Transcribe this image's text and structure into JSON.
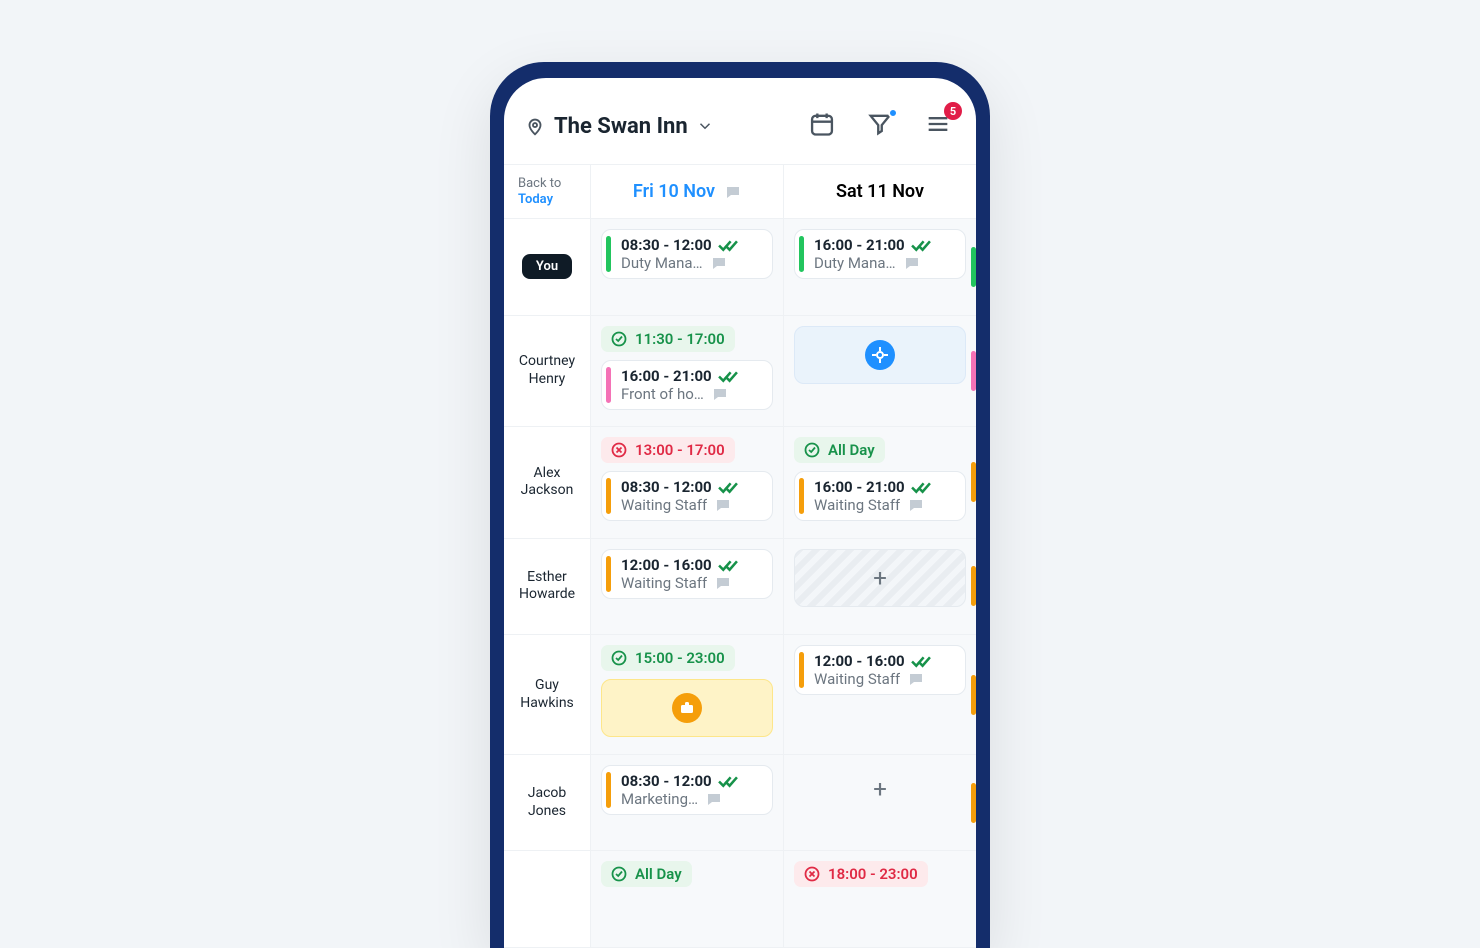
{
  "header": {
    "location": "The Swan Inn",
    "notifications": "5"
  },
  "dates": {
    "back": {
      "line1": "Back to",
      "line2": "Today"
    },
    "day1": "Fri 10 Nov",
    "day2": "Sat 11 Nov"
  },
  "rows": [
    {
      "you_label": "You",
      "d1": {
        "shift": {
          "time": "08:30 - 12:00",
          "role": "Duty Mana…",
          "bar": "green"
        }
      },
      "d2": {
        "shift": {
          "time": "16:00 - 21:00",
          "role": "Duty Mana…",
          "bar": "green"
        },
        "edge": "green"
      }
    },
    {
      "name": "Courtney Henry",
      "d1": {
        "avail_ok": "11:30 - 17:00",
        "shift": {
          "time": "16:00 - 21:00",
          "role": "Front of ho…",
          "bar": "pink"
        }
      },
      "d2": {
        "placeholder_blue": true,
        "edge": "pink"
      }
    },
    {
      "name": "Alex Jackson",
      "d1": {
        "avail_no": "13:00 - 17:00",
        "shift": {
          "time": "08:30 - 12:00",
          "role": "Waiting Staff",
          "bar": "amber"
        }
      },
      "d2": {
        "avail_ok": "All Day",
        "shift": {
          "time": "16:00 - 21:00",
          "role": "Waiting Staff",
          "bar": "amber"
        },
        "edge": "amber"
      }
    },
    {
      "name": "Esther Howarde",
      "d1": {
        "shift": {
          "time": "12:00 - 16:00",
          "role": "Waiting Staff",
          "bar": "amber"
        }
      },
      "d2": {
        "hatched_add": true,
        "edge": "amber"
      }
    },
    {
      "name": "Guy Hawkins",
      "d1": {
        "avail_ok": "15:00 - 23:00",
        "placeholder_amber": true
      },
      "d2": {
        "shift": {
          "time": "12:00 - 16:00",
          "role": "Waiting Staff",
          "bar": "amber"
        },
        "edge": "amber"
      }
    },
    {
      "name": "Jacob Jones",
      "d1": {
        "shift": {
          "time": "08:30 - 12:00",
          "role": "Marketing…",
          "bar": "amber"
        }
      },
      "d2": {
        "plain_add": true,
        "edge": "amber"
      }
    },
    {
      "name": "",
      "d1": {
        "avail_ok": "All Day"
      },
      "d2": {
        "avail_no": "18:00 - 23:00"
      }
    }
  ]
}
